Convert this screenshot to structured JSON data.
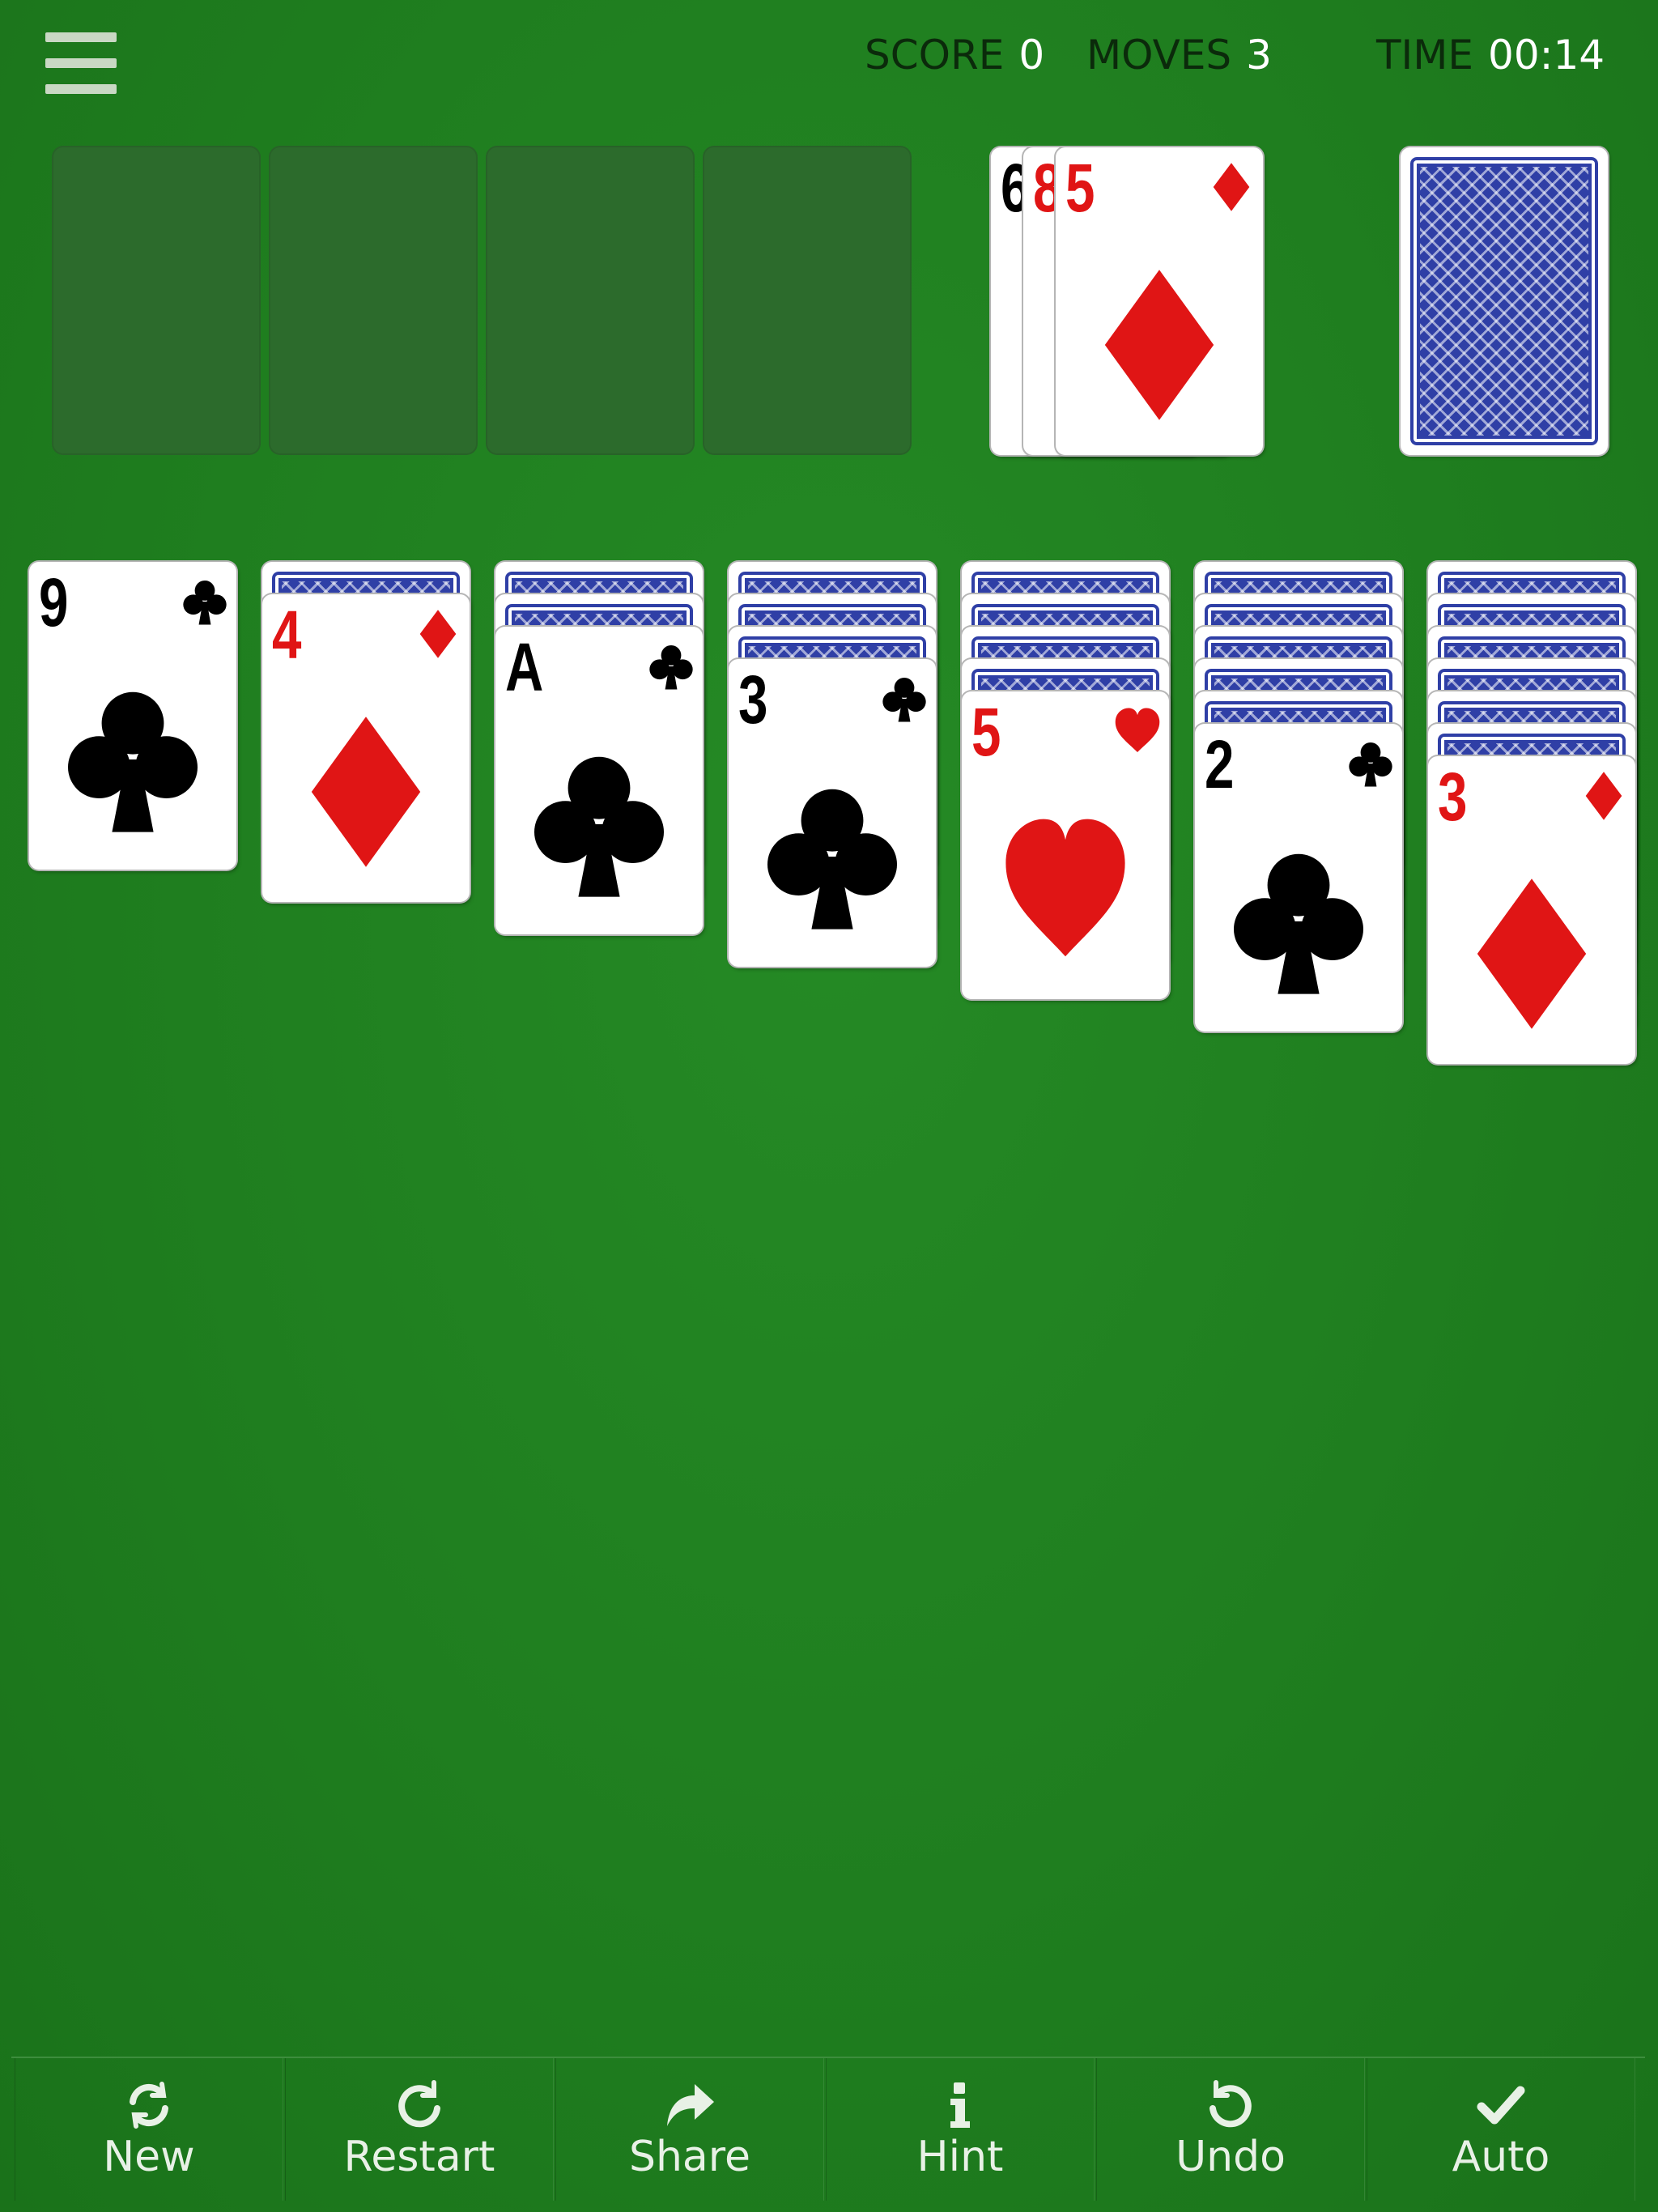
{
  "header": {
    "menu_icon": "hamburger-menu-icon",
    "score_label": "SCORE",
    "score_value": "0",
    "moves_label": "MOVES",
    "moves_value": "3",
    "time_label": "TIME",
    "time_value": "00:14"
  },
  "colors": {
    "felt": "#1f7e1f",
    "red_suit": "#e01515",
    "card_back": "#2f3fa6"
  },
  "foundations": [
    {
      "empty": true
    },
    {
      "empty": true
    },
    {
      "empty": true
    },
    {
      "empty": true
    }
  ],
  "waste": {
    "cards": [
      {
        "rank": "6",
        "suit": "clubs",
        "color": "black"
      },
      {
        "rank": "8",
        "suit": "diamonds",
        "color": "red"
      },
      {
        "rank": "5",
        "suit": "diamonds",
        "color": "red"
      }
    ]
  },
  "stock": {
    "face_down": true
  },
  "tableau": [
    {
      "hidden": 0,
      "card": {
        "rank": "9",
        "suit": "clubs",
        "color": "black"
      }
    },
    {
      "hidden": 1,
      "card": {
        "rank": "4",
        "suit": "diamonds",
        "color": "red"
      }
    },
    {
      "hidden": 2,
      "card": {
        "rank": "A",
        "suit": "clubs",
        "color": "black"
      }
    },
    {
      "hidden": 3,
      "card": {
        "rank": "3",
        "suit": "clubs",
        "color": "black"
      }
    },
    {
      "hidden": 4,
      "card": {
        "rank": "5",
        "suit": "hearts",
        "color": "red"
      }
    },
    {
      "hidden": 5,
      "card": {
        "rank": "2",
        "suit": "clubs",
        "color": "black"
      }
    },
    {
      "hidden": 6,
      "card": {
        "rank": "3",
        "suit": "diamonds",
        "color": "red"
      }
    }
  ],
  "toolbar": {
    "new_label": "New",
    "restart_label": "Restart",
    "share_label": "Share",
    "hint_label": "Hint",
    "undo_label": "Undo",
    "auto_label": "Auto"
  }
}
